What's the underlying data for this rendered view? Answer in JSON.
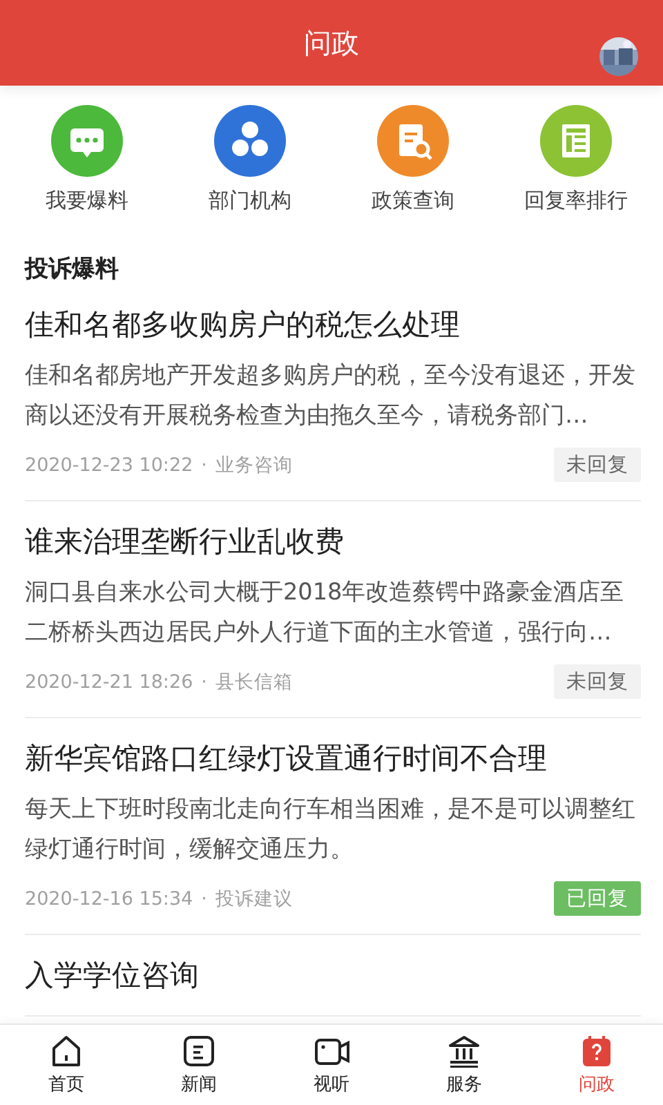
{
  "header": {
    "title": "问政"
  },
  "quick_links": [
    {
      "label": "我要爆料",
      "kind": "chat",
      "color": "#4cb83c"
    },
    {
      "label": "部门机构",
      "kind": "org",
      "color": "#2f73d8"
    },
    {
      "label": "政策查询",
      "kind": "policy",
      "color": "#ef8a2a"
    },
    {
      "label": "回复率排行",
      "kind": "ranking",
      "color": "#8cc234"
    }
  ],
  "section_title": "投诉爆料",
  "posts": [
    {
      "title": "佳和名都多收购房户的税怎么处理",
      "summary": "佳和名都房地产开发超多购房户的税，至今没有退还，开发商以还没有开展税务检查为由拖久至今，请税务部门…",
      "date": "2020-12-23 10:22",
      "separator": "·",
      "category": "业务咨询",
      "status": {
        "label": "未回复",
        "kind": "pending"
      }
    },
    {
      "title": "谁来治理垄断行业乱收费",
      "summary": "洞口县自来水公司大概于2018年改造蔡锷中路豪金酒店至二桥桥头西边居民户外人行道下面的主水管道，强行向…",
      "date": "2020-12-21 18:26",
      "separator": "·",
      "category": "县长信箱",
      "status": {
        "label": "未回复",
        "kind": "pending"
      }
    },
    {
      "title": "新华宾馆路口红绿灯设置通行时间不合理",
      "summary": "每天上下班时段南北走向行车相当困难，是不是可以调整红绿灯通行时间，缓解交通压力。",
      "date": "2020-12-16 15:34",
      "separator": "·",
      "category": "投诉建议",
      "status": {
        "label": "已回复",
        "kind": "replied"
      }
    },
    {
      "title": "入学学位咨询"
    }
  ],
  "tabs": [
    {
      "label": "首页",
      "kind": "home",
      "selected": false
    },
    {
      "label": "新闻",
      "kind": "news",
      "selected": false
    },
    {
      "label": "视听",
      "kind": "video",
      "selected": false
    },
    {
      "label": "服务",
      "kind": "service",
      "selected": false
    },
    {
      "label": "问政",
      "kind": "ask",
      "selected": true
    }
  ]
}
